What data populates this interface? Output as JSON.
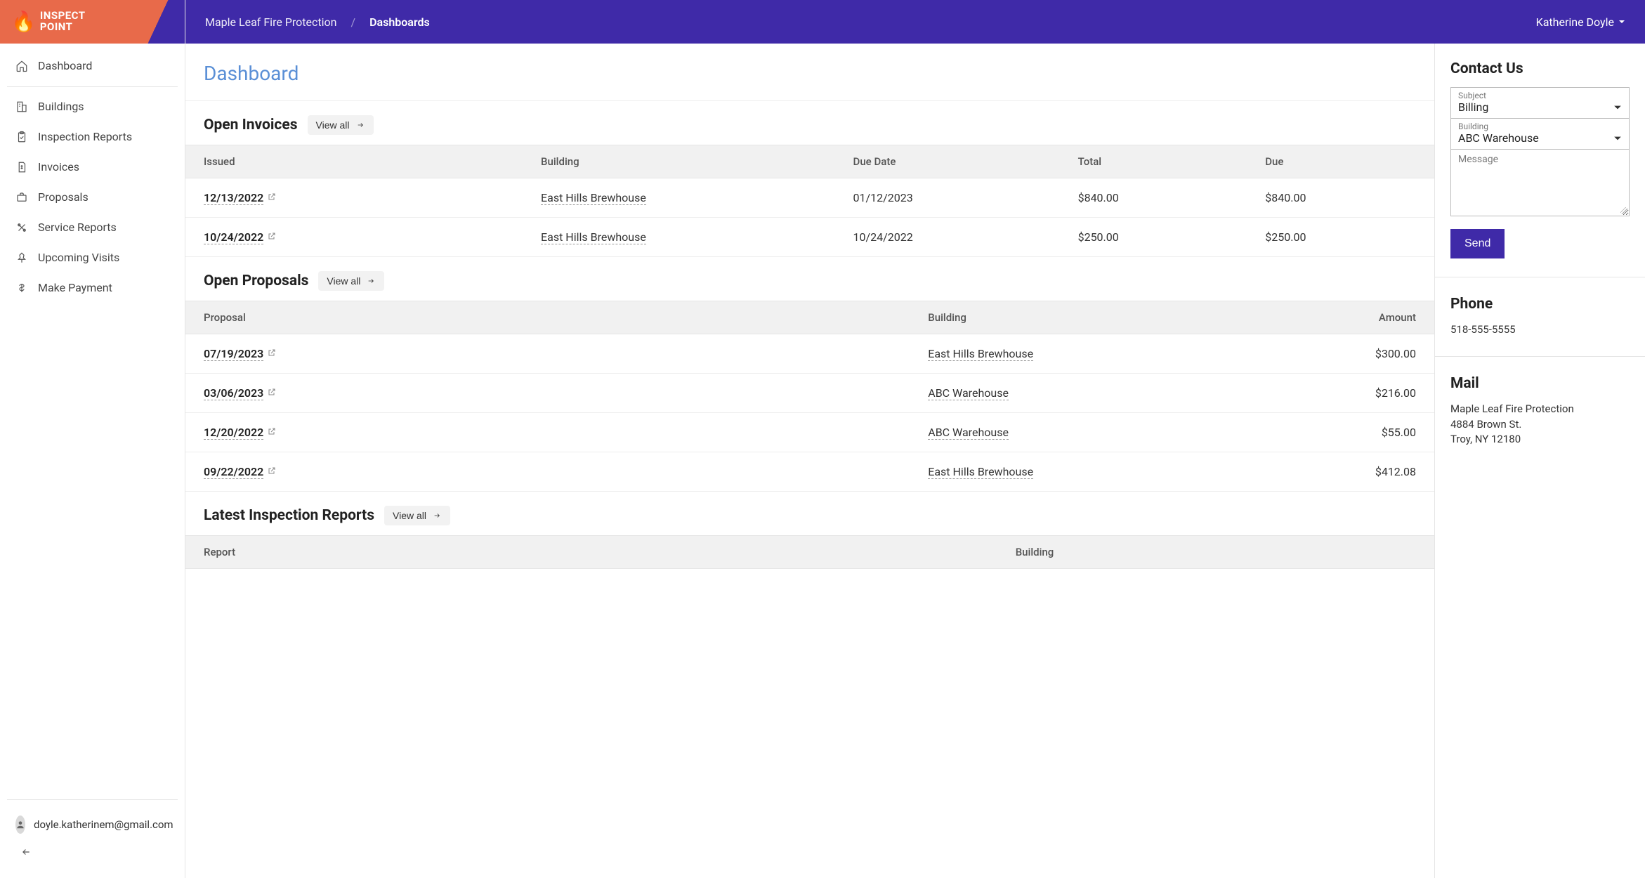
{
  "logo": {
    "line1": "INSPECT",
    "line2": "POINT"
  },
  "nav": {
    "dashboard": "Dashboard",
    "buildings": "Buildings",
    "inspection_reports": "Inspection Reports",
    "invoices": "Invoices",
    "proposals": "Proposals",
    "service_reports": "Service Reports",
    "upcoming_visits": "Upcoming Visits",
    "make_payment": "Make Payment"
  },
  "footer_user_email": "doyle.katherinem@gmail.com",
  "header": {
    "org": "Maple Leaf Fire Protection",
    "current": "Dashboards",
    "user": "Katherine Doyle"
  },
  "page_title": "Dashboard",
  "sections": {
    "open_invoices": {
      "title": "Open Invoices",
      "view_all": "View all",
      "cols": {
        "issued": "Issued",
        "building": "Building",
        "due_date": "Due Date",
        "total": "Total",
        "due": "Due"
      },
      "rows": [
        {
          "issued": "12/13/2022",
          "building": "East Hills Brewhouse",
          "due_date": "01/12/2023",
          "total": "$840.00",
          "due": "$840.00"
        },
        {
          "issued": "10/24/2022",
          "building": "East Hills Brewhouse",
          "due_date": "10/24/2022",
          "total": "$250.00",
          "due": "$250.00"
        }
      ]
    },
    "open_proposals": {
      "title": "Open Proposals",
      "view_all": "View all",
      "cols": {
        "proposal": "Proposal",
        "building": "Building",
        "amount": "Amount"
      },
      "rows": [
        {
          "proposal": "07/19/2023",
          "building": "East Hills Brewhouse",
          "amount": "$300.00"
        },
        {
          "proposal": "03/06/2023",
          "building": "ABC Warehouse",
          "amount": "$216.00"
        },
        {
          "proposal": "12/20/2022",
          "building": "ABC Warehouse",
          "amount": "$55.00"
        },
        {
          "proposal": "09/22/2022",
          "building": "East Hills Brewhouse",
          "amount": "$412.08"
        }
      ]
    },
    "latest_inspection_reports": {
      "title": "Latest Inspection Reports",
      "view_all": "View all",
      "cols": {
        "report": "Report",
        "building": "Building"
      }
    }
  },
  "contact": {
    "title": "Contact Us",
    "subject_label": "Subject",
    "subject_value": "Billing",
    "building_label": "Building",
    "building_value": "ABC Warehouse",
    "message_placeholder": "Message",
    "send": "Send",
    "phone_title": "Phone",
    "phone_value": "518-555-5555",
    "mail_title": "Mail",
    "mail_line1": "Maple Leaf Fire Protection",
    "mail_line2": "4884 Brown St.",
    "mail_line3": "Troy, NY 12180"
  }
}
